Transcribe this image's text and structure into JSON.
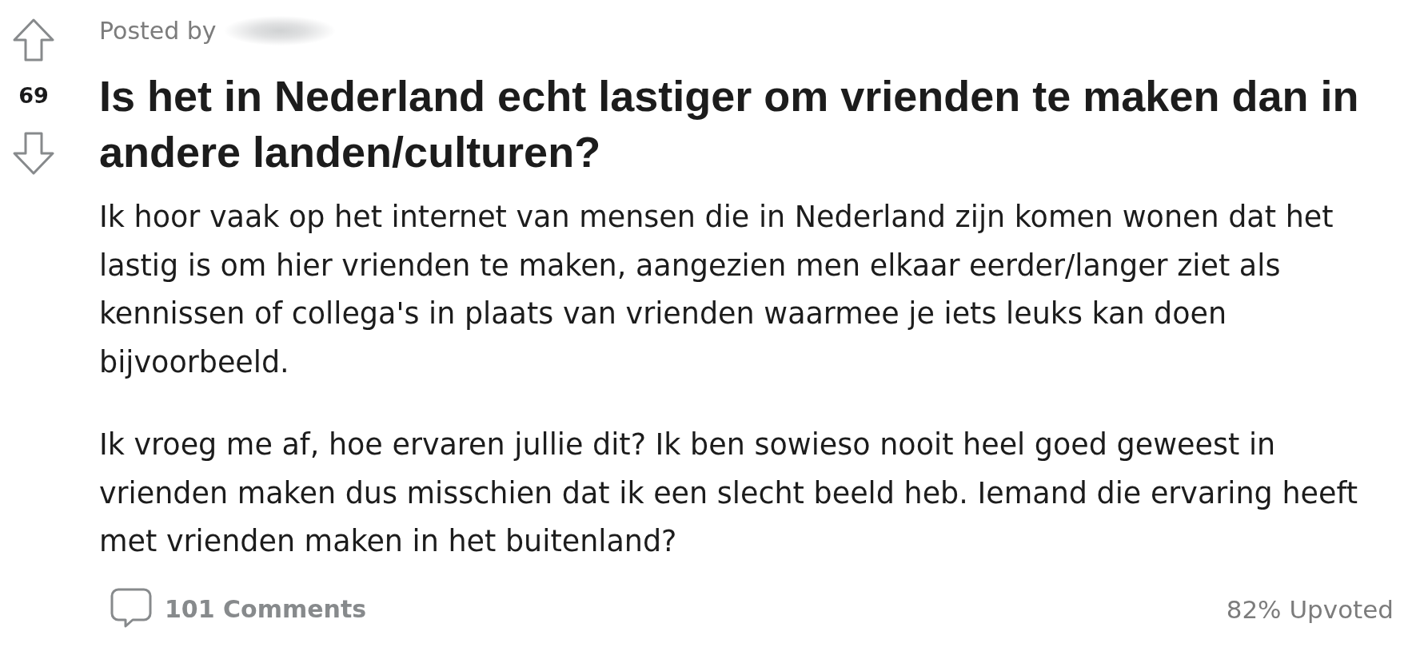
{
  "vote": {
    "score": "69"
  },
  "post": {
    "byline": "Posted by",
    "title": "Is het in Nederland echt lastiger om vrienden te maken dan in andere landen/culturen?",
    "paragraphs": [
      "Ik hoor vaak op het internet van mensen die in Nederland zijn komen wonen dat het lastig is om hier vrienden te maken, aangezien men elkaar eerder/langer ziet als kennissen of collega's in plaats van vrienden waarmee je iets leuks kan doen bijvoorbeeld.",
      "Ik vroeg me af, hoe ervaren jullie dit? Ik ben sowieso nooit heel goed geweest in vrienden maken dus misschien dat ik een slecht beeld heb. Iemand die ervaring heeft met vrienden maken in het buitenland?"
    ]
  },
  "footer": {
    "comments": "101 Comments",
    "upvoted": "82% Upvoted"
  }
}
